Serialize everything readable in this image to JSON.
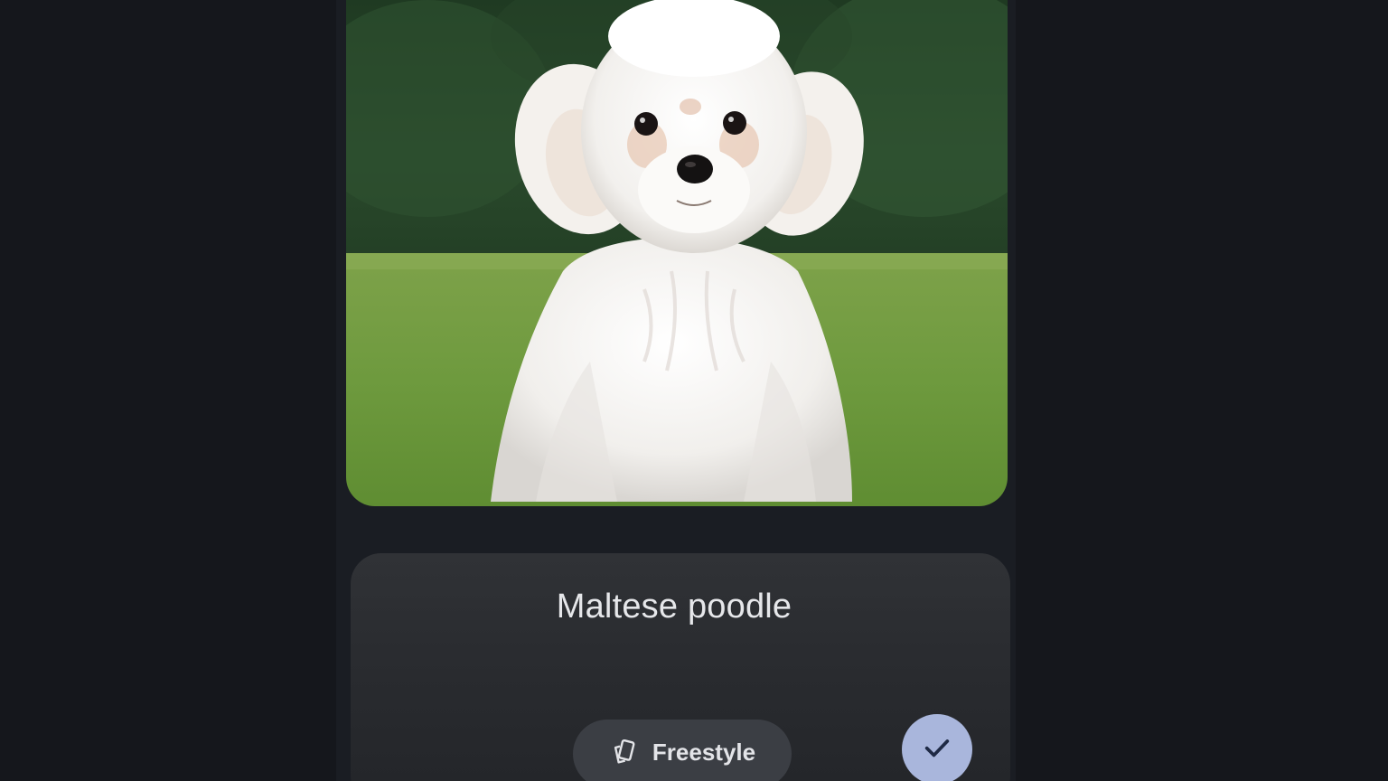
{
  "generated_image": {
    "subject": "white fluffy dog sitting on grass"
  },
  "prompt": {
    "text": "Maltese poodle"
  },
  "style_chip": {
    "label": "Freestyle",
    "icon": "cards-icon"
  },
  "confirm_button": {
    "icon": "checkmark-icon"
  },
  "colors": {
    "background": "#15171c",
    "panel": "#2c2e32",
    "chip": "#3b3e44",
    "accent": "#a9b6dc"
  }
}
